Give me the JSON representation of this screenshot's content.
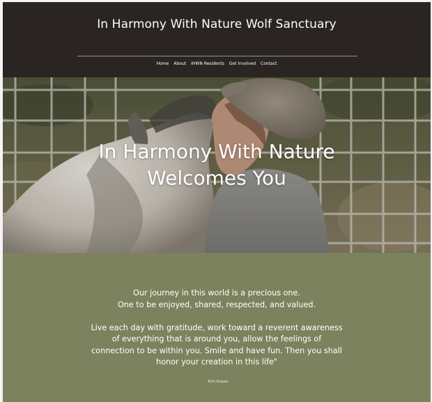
{
  "header": {
    "title": "In Harmony With Nature Wolf Sanctuary",
    "nav": [
      "Home",
      "About",
      "IHWN Residents",
      "Get Involved",
      "Contact"
    ]
  },
  "hero": {
    "line1": "In Harmony With Nature",
    "line2": "Welcomes You"
  },
  "quote": {
    "lines1": [
      "Our journey in this world is a precious one.",
      "One to be enjoyed, shared, respected, and valued."
    ],
    "lines2": [
      "Live each day with gratitude, work toward a reverent awareness",
      "of everything that is around you, allow the feelings of",
      "connection to be within you. Smile and have fun. Then you shall",
      "honor your creation in this life\""
    ],
    "attribution": "- Kim Kopas"
  },
  "colors": {
    "header_bg": "#2a2522",
    "section_bg": "#7d825e"
  }
}
